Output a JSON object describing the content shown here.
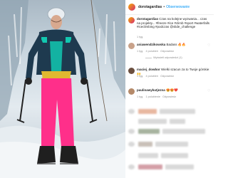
{
  "post": {
    "username": "dorotagardias",
    "follow_label": "Obserwowanie",
    "caption_user": "dorotagardias",
    "caption_text": "Czas na kolejne wyzwania... czas na projekty... #freeze #ice #climb #sport #waterfalls #iceclimbing #podczas @slide_challenge",
    "caption_time": "1 tyg."
  },
  "comments": [
    {
      "user": "aniawendzikowska",
      "text": "Badass",
      "emoji": "🔥🔥",
      "time": "1 tyg.",
      "likes": "4 polubień",
      "reply": "Odpowiedz",
      "view_replies": "Wyświetl odpowiedzi (1)"
    },
    {
      "user": "maciej_dowbor",
      "text": "Wielki szacun za to Twoje górskie",
      "emoji": "🙌",
      "time": "1 tyg.",
      "likes": "4 polubień",
      "reply": "Odpowiedz"
    },
    {
      "user": "paulinawykutjezna",
      "text": "",
      "emoji": "😍😍❤️",
      "time": "1 tyg.",
      "likes": "1 polubienie",
      "reply": "Odpowiedz"
    }
  ],
  "icons": {
    "like": "heart-icon",
    "avatar": "avatar-icon"
  },
  "colors": {
    "link": "#0095f6",
    "muted": "#8e8e8e",
    "jacket": "#1e3a4f",
    "pants": "#ff2f8a",
    "accent": "#12c8b0"
  }
}
